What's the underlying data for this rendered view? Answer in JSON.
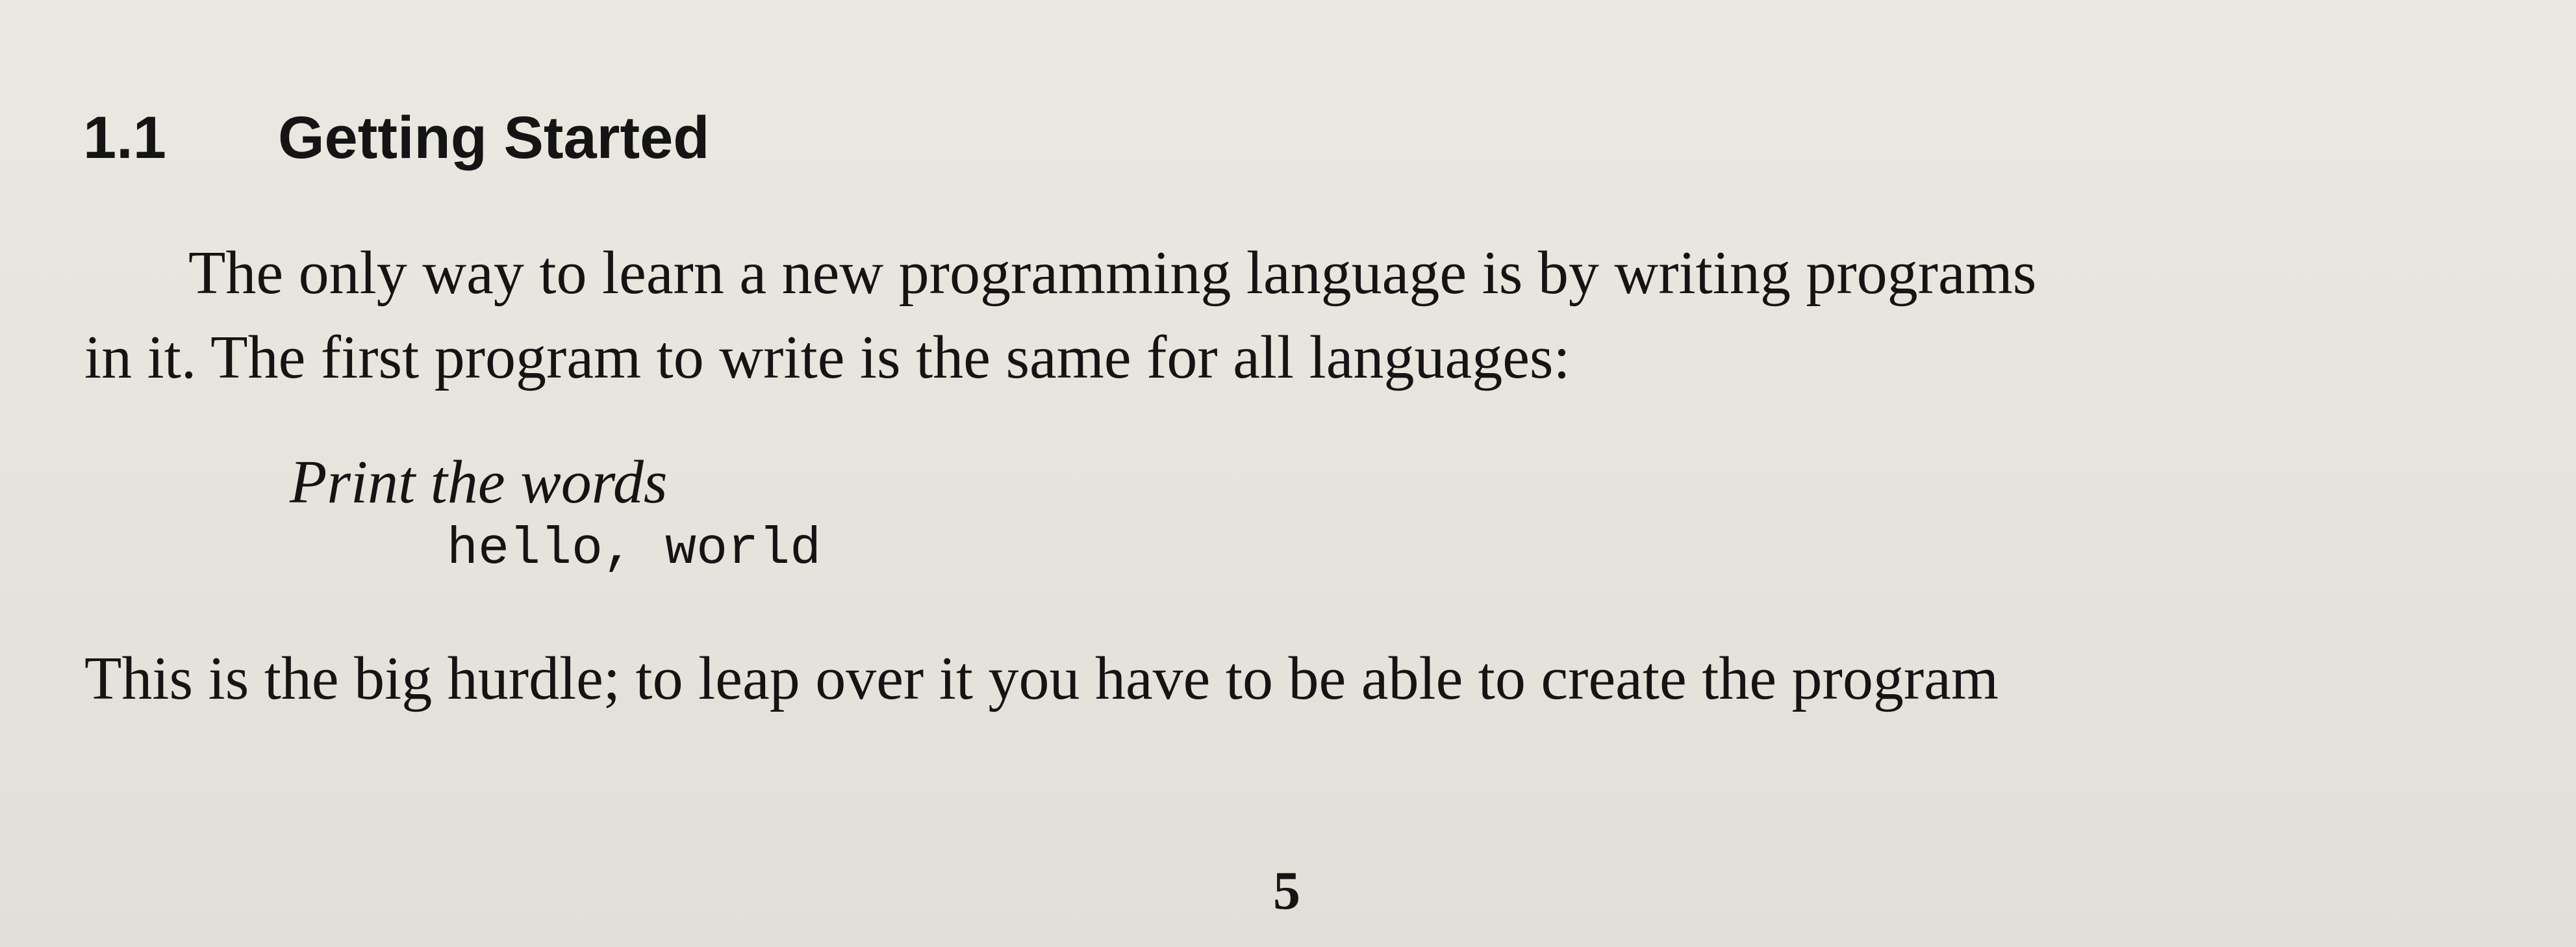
{
  "section": {
    "number": "1.1",
    "title": "Getting Started"
  },
  "paragraph": {
    "line1": "The only way to learn a new programming language is by writing programs",
    "line2": "in it.  The first program to write is the same for all languages:"
  },
  "example": {
    "instruction": "Print the words",
    "code": "hello, world"
  },
  "continuation": "This is the big hurdle; to leap over it you have to be able to create the program",
  "page_number": "5"
}
